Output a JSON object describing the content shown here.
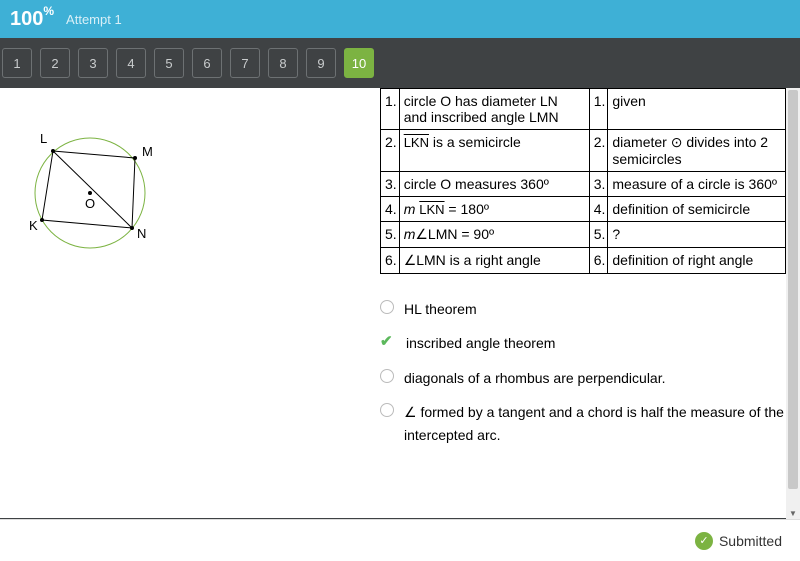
{
  "header": {
    "score": "100",
    "pct": "%",
    "attempt": "Attempt 1"
  },
  "nav": [
    "1",
    "2",
    "3",
    "4",
    "5",
    "6",
    "7",
    "8",
    "9",
    "10"
  ],
  "nav_active_index": 9,
  "diagram": {
    "labels": {
      "L": "L",
      "M": "M",
      "K": "K",
      "N": "N",
      "O": "O"
    }
  },
  "proof": [
    {
      "n": "1.",
      "statement_pre": "circle O has diameter LN and inscribed angle LMN",
      "rn": "1.",
      "reason": "given"
    },
    {
      "n": "2.",
      "arc": "LKN",
      "statement_post": " is a semicircle",
      "rn": "2.",
      "reason": "diameter ⊙ divides into 2 semicircles"
    },
    {
      "n": "3.",
      "statement_pre": "circle O measures 360º",
      "rn": "3.",
      "reason": "measure of a circle is 360º"
    },
    {
      "n": "4.",
      "m_italic": "m ",
      "arc": "LKN",
      "statement_post": " = 180º",
      "rn": "4.",
      "reason": "definition of semicircle"
    },
    {
      "n": "5.",
      "m_italic": "m",
      "statement_post": "∠LMN = 90º",
      "rn": "5.",
      "reason": "?"
    },
    {
      "n": "6.",
      "statement_pre": " ∠LMN is a right angle",
      "rn": "6.",
      "reason": "definition of right angle"
    }
  ],
  "options": [
    {
      "correct": false,
      "text": "HL theorem"
    },
    {
      "correct": true,
      "text": "inscribed angle theorem"
    },
    {
      "correct": false,
      "text": " diagonals of a rhombus are perpendicular."
    },
    {
      "correct": false,
      "text": "∠ formed by a tangent and a chord is half the measure of the intercepted arc."
    }
  ],
  "footer": {
    "submitted": "Submitted",
    "check": "✓"
  }
}
